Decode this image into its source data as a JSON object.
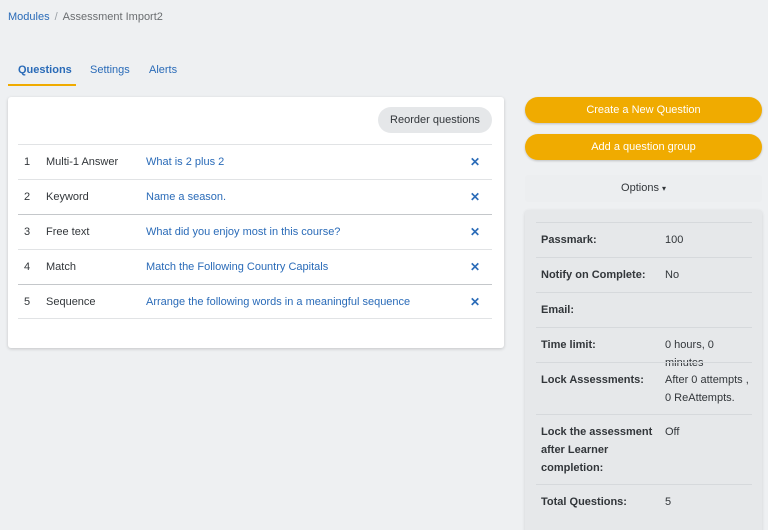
{
  "breadcrumb": {
    "parent": "Modules",
    "separator": "/",
    "current": "Assessment Import2"
  },
  "tabs": [
    {
      "label": "Questions",
      "active": true
    },
    {
      "label": "Settings",
      "active": false
    },
    {
      "label": "Alerts",
      "active": false
    }
  ],
  "questions": {
    "reorder_label": "Reorder questions",
    "delete_glyph": "✕",
    "rows": [
      {
        "num": "1",
        "type": "Multi-1 Answer",
        "title": "What is 2 plus 2"
      },
      {
        "num": "2",
        "type": "Keyword",
        "title": "Name a season."
      },
      {
        "num": "3",
        "type": "Free text",
        "title": "What did you enjoy most in this course?"
      },
      {
        "num": "4",
        "type": "Match",
        "title": "Match the Following Country Capitals"
      },
      {
        "num": "5",
        "type": "Sequence",
        "title": "Arrange the following words in a meaningful sequence"
      }
    ]
  },
  "actions": {
    "create_label": "Create a New Question",
    "group_label": "Add a question group",
    "options_label": "Options",
    "options_caret": "▾"
  },
  "settings": [
    {
      "label": "Passmark:",
      "value": "100"
    },
    {
      "label": "Notify on Complete:",
      "value": "No"
    },
    {
      "label": "Email:",
      "value": ""
    },
    {
      "label": "Time limit:",
      "value": "0 hours, 0 minutes"
    },
    {
      "label": "Lock Assessments:",
      "value": "After 0 attempts ,\n0 ReAttempts."
    },
    {
      "label": "Lock the assessment\nafter Learner\ncompletion:",
      "value": "Off"
    },
    {
      "label": "Total Questions:",
      "value": "5"
    }
  ],
  "colors": {
    "accent": "#f0ab00",
    "link": "#2a6bb8",
    "background": "#eef0f2"
  }
}
